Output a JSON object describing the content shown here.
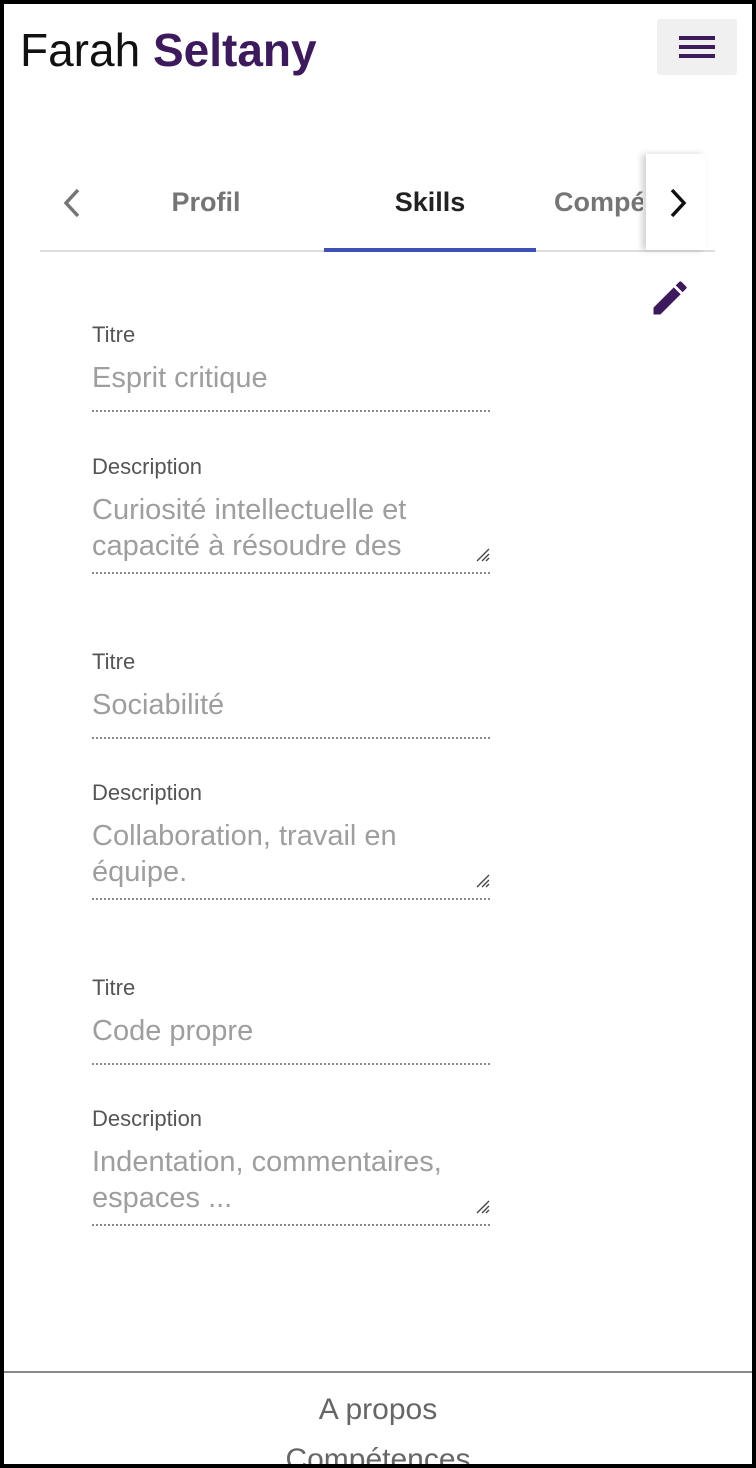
{
  "header": {
    "first_name": "Farah",
    "last_name": "Seltany",
    "menu_icon": "hamburger-icon",
    "accent_color": "#3d1a5b"
  },
  "tabs": {
    "prev_icon": "chevron-left-icon",
    "next_icon": "chevron-right-icon",
    "items": [
      {
        "label": "Profil"
      },
      {
        "label": "Skills"
      },
      {
        "label": "Compé"
      }
    ],
    "active_color": "#3f51b5"
  },
  "edit_icon": "pencil-icon",
  "skills": [
    {
      "title_label": "Titre",
      "title_value": "Esprit critique",
      "desc_label": "Description",
      "desc_line1": "Curiosité intellectuelle et",
      "desc_line2": "capacité à résoudre des"
    },
    {
      "title_label": "Titre",
      "title_value": "Sociabilité",
      "desc_label": "Description",
      "desc_line1": "Collaboration, travail en",
      "desc_line2": "équipe."
    },
    {
      "title_label": "Titre",
      "title_value": "Code propre",
      "desc_label": "Description",
      "desc_line1": "Indentation, commentaires,",
      "desc_line2": "espaces ..."
    }
  ],
  "footer": {
    "links": [
      "A propos",
      "Compétences"
    ]
  }
}
